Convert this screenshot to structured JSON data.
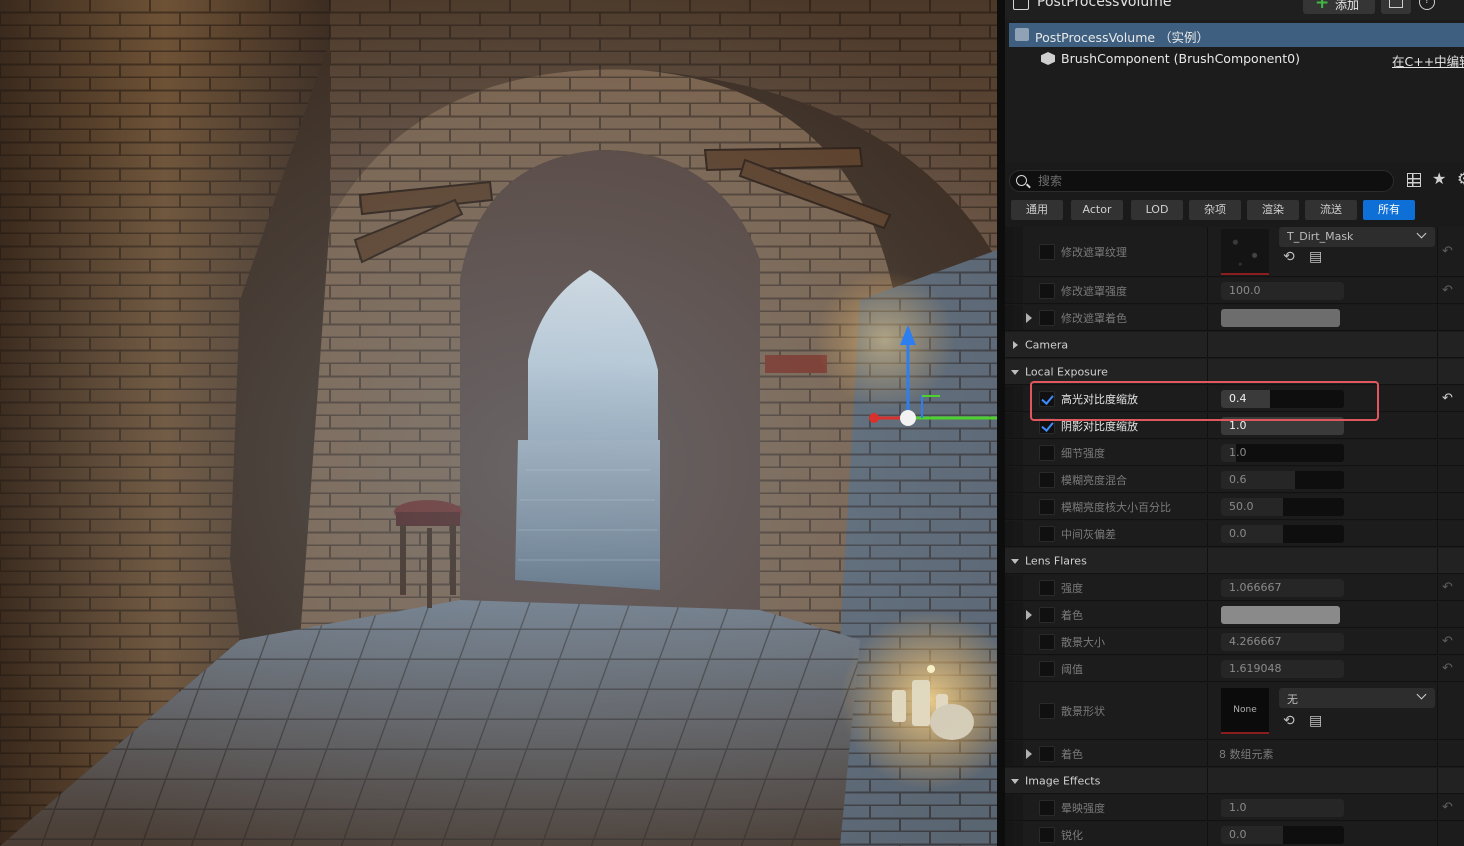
{
  "window": {
    "title": "PostProcessVolume",
    "add_button": "添加"
  },
  "components": [
    {
      "label": "PostProcessVolume （实例）",
      "selected": true
    },
    {
      "label": "BrushComponent (BrushComponent0)",
      "link": "在C++中编辑"
    }
  ],
  "search": {
    "placeholder": "搜索"
  },
  "filters": [
    "通用",
    "Actor",
    "LOD",
    "杂项",
    "渲染",
    "流送",
    "所有"
  ],
  "active_filter": "所有",
  "properties": {
    "dirt_mask_texture": {
      "label": "修改遮罩纹理",
      "asset": "T_Dirt_Mask"
    },
    "dirt_mask_intensity": {
      "label": "修改遮罩强度",
      "value": "100.0"
    },
    "dirt_mask_tint": {
      "label": "修改遮罩着色"
    },
    "camera": {
      "label": "Camera"
    },
    "local_exposure": {
      "label": "Local Exposure",
      "highlight_contrast": {
        "label": "高光对比度缩放",
        "value": "0.4",
        "checked": true
      },
      "shadow_contrast": {
        "label": "阴影对比度缩放",
        "value": "1.0",
        "checked": true
      },
      "detail_strength": {
        "label": "细节强度",
        "value": "1.0"
      },
      "blurred_luminance_blend": {
        "label": "模糊亮度混合",
        "value": "0.6"
      },
      "blurred_luminance_kernel": {
        "label": "模糊亮度核大小百分比",
        "value": "50.0"
      },
      "middle_grey_bias": {
        "label": "中间灰偏差",
        "value": "0.0"
      }
    },
    "lens_flares": {
      "label": "Lens Flares",
      "intensity": {
        "label": "强度",
        "value": "1.066667"
      },
      "tint": {
        "label": "着色"
      },
      "bokeh_size": {
        "label": "散景大小",
        "value": "4.266667"
      },
      "threshold": {
        "label": "阈值",
        "value": "1.619048"
      },
      "bokeh_shape": {
        "label": "散景形状",
        "thumb": "None",
        "asset": "无"
      },
      "tints": {
        "label": "着色",
        "value": "8 数组元素"
      }
    },
    "image_effects": {
      "label": "Image Effects",
      "vignette": {
        "label": "晕映强度",
        "value": "1.0"
      },
      "sharpen": {
        "label": "锐化",
        "value": "0.0"
      }
    }
  },
  "colors": {
    "accent": "#0e6fd6",
    "selection": "#3e5f80",
    "highlight_box": "#e0575e",
    "checkbox_check": "#3f8cff"
  }
}
